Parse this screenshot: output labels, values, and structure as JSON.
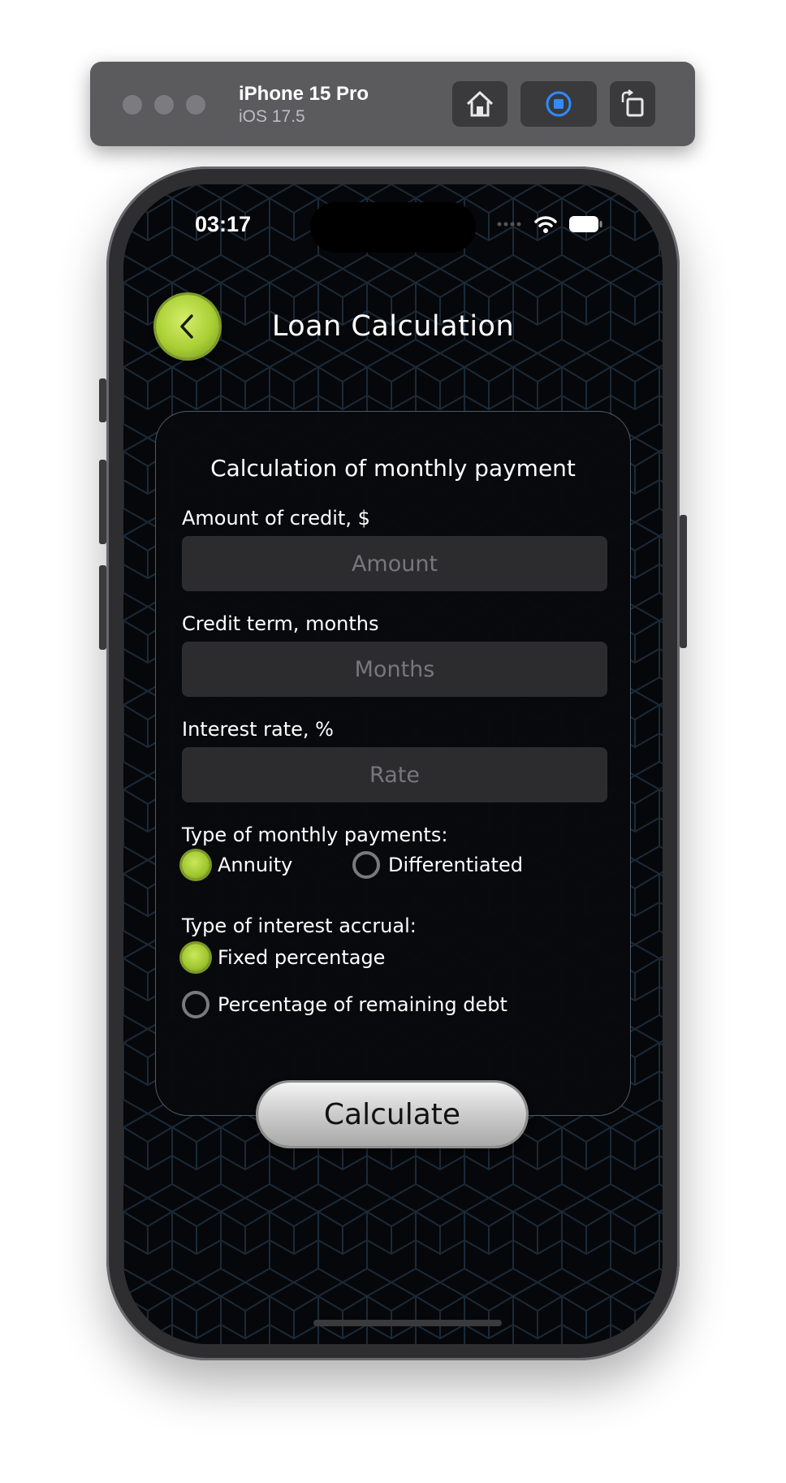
{
  "simulator": {
    "device_name": "iPhone 15 Pro",
    "os_version": "iOS 17.5",
    "buttons": [
      "home-icon",
      "screenshot-icon",
      "rotate-icon"
    ]
  },
  "status_bar": {
    "time": "03:17"
  },
  "header": {
    "title": "Loan Calculation",
    "back_icon": "chevron-left-icon"
  },
  "form": {
    "title": "Calculation of monthly payment",
    "amount": {
      "label": "Amount of credit, $",
      "placeholder": "Amount",
      "value": ""
    },
    "term": {
      "label": "Credit term, months",
      "placeholder": "Months",
      "value": ""
    },
    "rate": {
      "label": "Interest rate, %",
      "placeholder": "Rate",
      "value": ""
    },
    "payment_type": {
      "label": "Type of monthly payments:",
      "options": [
        {
          "label": "Annuity",
          "selected": true
        },
        {
          "label": "Differentiated",
          "selected": false
        }
      ]
    },
    "accrual_type": {
      "label": "Type of interest accrual:",
      "options": [
        {
          "label": "Fixed percentage",
          "selected": true
        },
        {
          "label": "Percentage of remaining debt",
          "selected": false
        }
      ]
    },
    "calculate_label": "Calculate"
  },
  "colors": {
    "accent_green": "#a9cf35",
    "background": "#06070a",
    "input_bg": "#2c2c2f"
  }
}
